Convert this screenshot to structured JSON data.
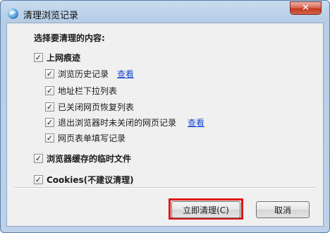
{
  "window": {
    "title": "清理浏览记录",
    "close_symbol": "✕"
  },
  "dialog": {
    "heading": "选择要清理的内容:",
    "groups": [
      {
        "label": "上网痕迹",
        "checked": true,
        "items": [
          {
            "label": "浏览历史记录",
            "checked": true,
            "link": "查看"
          },
          {
            "label": "地址栏下拉列表",
            "checked": true
          },
          {
            "label": "已关闭网页恢复列表",
            "checked": true
          },
          {
            "label": "退出浏览器时未关闭的网页记录",
            "checked": true,
            "link": "查看"
          },
          {
            "label": "网页表单填写记录",
            "checked": true
          }
        ]
      },
      {
        "label": "浏览器缓存的临时文件",
        "checked": true
      },
      {
        "label": "Cookies(不建议清理)",
        "checked": true
      }
    ]
  },
  "buttons": {
    "primary": "立即清理(C)",
    "cancel": "取消"
  },
  "check_mark": "✓"
}
